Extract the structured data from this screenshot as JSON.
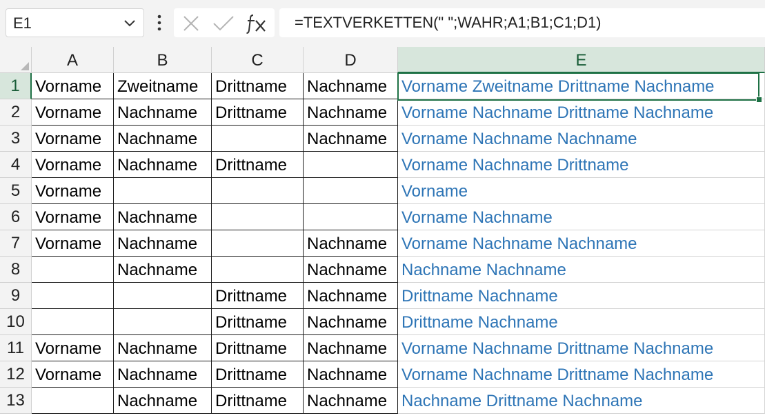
{
  "name_box": {
    "value": "E1"
  },
  "formula_bar": {
    "formula": "=TEXTVERKETTEN(\" \";WAHR;A1;B1;C1;D1)"
  },
  "icons": {
    "name_box_dropdown": "chevron-down-icon",
    "more_options": "vertical-ellipsis-icon",
    "cancel": "x-icon",
    "enter": "checkmark-icon",
    "insert_function": "fx-icon"
  },
  "colors": {
    "accent": "#1e7145",
    "result_text": "#2e75b6",
    "header_bg": "#f3f3f3",
    "active_header_bg": "#d7e6dc"
  },
  "selected_cell": "E1",
  "columns": [
    "A",
    "B",
    "C",
    "D",
    "E"
  ],
  "rows": [
    {
      "num": "1",
      "cells": [
        "Vorname",
        "Zweitname",
        "Drittname",
        "Nachname",
        "Vorname Zweitname Drittname Nachname"
      ]
    },
    {
      "num": "2",
      "cells": [
        "Vorname",
        "Nachname",
        "Drittname",
        "Nachname",
        "Vorname Nachname Drittname Nachname"
      ]
    },
    {
      "num": "3",
      "cells": [
        "Vorname",
        "Nachname",
        "",
        "Nachname",
        "Vorname Nachname Nachname"
      ]
    },
    {
      "num": "4",
      "cells": [
        "Vorname",
        "Nachname",
        "Drittname",
        "",
        "Vorname Nachname Drittname"
      ]
    },
    {
      "num": "5",
      "cells": [
        "Vorname",
        "",
        "",
        "",
        "Vorname"
      ]
    },
    {
      "num": "6",
      "cells": [
        "Vorname",
        "Nachname",
        "",
        "",
        "Vorname Nachname"
      ]
    },
    {
      "num": "7",
      "cells": [
        "Vorname",
        "Nachname",
        "",
        "Nachname",
        "Vorname Nachname Nachname"
      ]
    },
    {
      "num": "8",
      "cells": [
        "",
        "Nachname",
        "",
        "Nachname",
        "Nachname Nachname"
      ]
    },
    {
      "num": "9",
      "cells": [
        "",
        "",
        "Drittname",
        "Nachname",
        "Drittname Nachname"
      ]
    },
    {
      "num": "10",
      "cells": [
        "",
        "",
        "Drittname",
        "Nachname",
        "Drittname Nachname"
      ]
    },
    {
      "num": "11",
      "cells": [
        "Vorname",
        "Nachname",
        "Drittname",
        "Nachname",
        "Vorname Nachname Drittname Nachname"
      ]
    },
    {
      "num": "12",
      "cells": [
        "Vorname",
        "Nachname",
        "Drittname",
        "Nachname",
        "Vorname Nachname Drittname Nachname"
      ]
    },
    {
      "num": "13",
      "cells": [
        "",
        "Nachname",
        "Drittname",
        "Nachname",
        "Nachname Drittname Nachname"
      ]
    }
  ]
}
